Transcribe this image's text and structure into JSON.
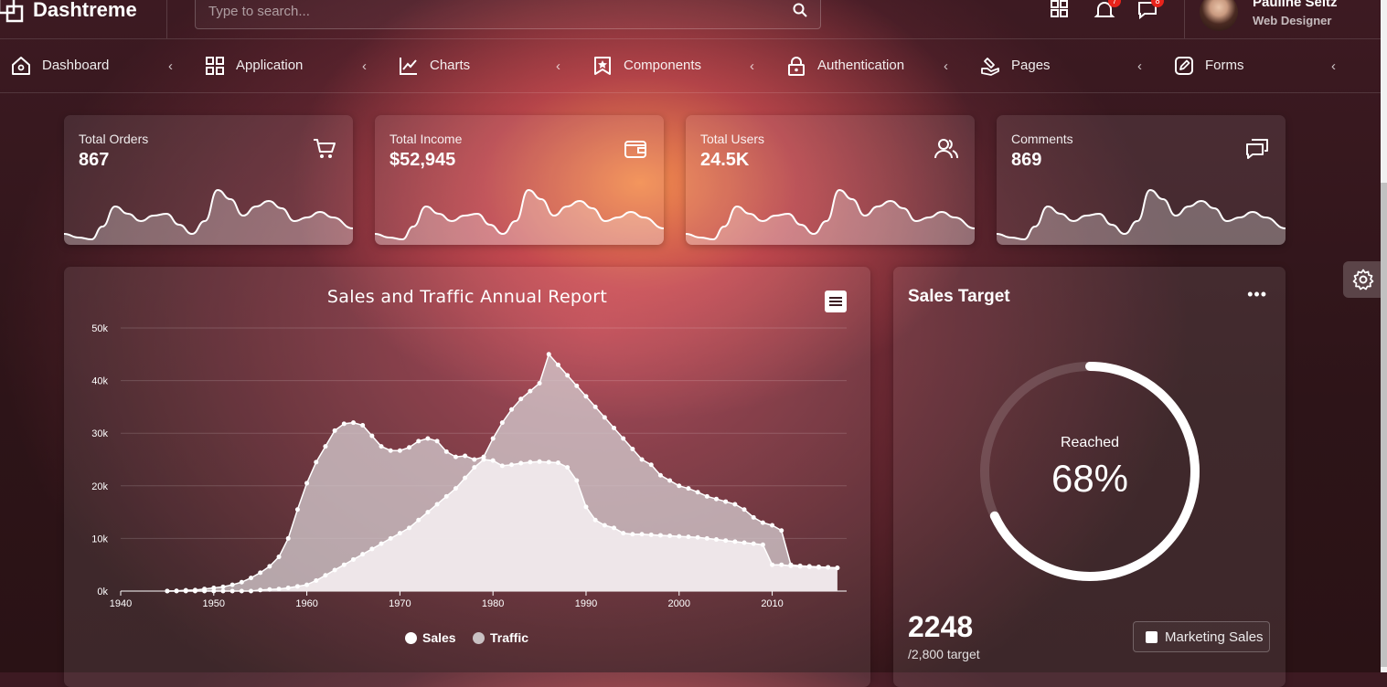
{
  "app": {
    "title": "Dashtreme"
  },
  "search": {
    "placeholder": "Type to search..."
  },
  "header": {
    "notifications_count": "7",
    "messages_count": "8"
  },
  "user": {
    "name": "Pauline Seitz",
    "role": "Web Designer"
  },
  "nav": {
    "items": [
      {
        "label": "Dashboard",
        "icon": "home-icon"
      },
      {
        "label": "Application",
        "icon": "grid-icon"
      },
      {
        "label": "Charts",
        "icon": "chart-line-icon"
      },
      {
        "label": "Components",
        "icon": "bookmark-icon"
      },
      {
        "label": "Authentication",
        "icon": "lock-icon"
      },
      {
        "label": "Pages",
        "icon": "pages-icon"
      },
      {
        "label": "Forms",
        "icon": "edit-icon"
      }
    ]
  },
  "stats": [
    {
      "label": "Total Orders",
      "value": "867",
      "icon": "cart-icon"
    },
    {
      "label": "Total Income",
      "value": "$52,945",
      "icon": "wallet-icon"
    },
    {
      "label": "Total Users",
      "value": "24.5K",
      "icon": "users-icon"
    },
    {
      "label": "Comments",
      "value": "869",
      "icon": "comments-icon"
    }
  ],
  "sales_target": {
    "title": "Sales Target",
    "gauge_label": "Reached",
    "gauge_value": "68%",
    "percent": 68,
    "number": "2248",
    "target": "/2,800 target",
    "button": "Marketing Sales"
  },
  "chart_data": {
    "type": "area",
    "title": "Sales and Traffic Annual Report",
    "xlim": [
      1940,
      2018
    ],
    "ylim": [
      0,
      50000
    ],
    "x_ticks": [
      1940,
      1950,
      1960,
      1970,
      1980,
      1990,
      2000,
      2010
    ],
    "y_ticks": [
      0,
      10000,
      20000,
      30000,
      40000,
      50000
    ],
    "y_tick_labels": [
      "0k",
      "10k",
      "20k",
      "30k",
      "40k",
      "50k"
    ],
    "grid": true,
    "legend": "bottom",
    "series": [
      {
        "name": "Sales",
        "color": "#ffffff",
        "x": [
          1945,
          1946,
          1947,
          1948,
          1949,
          1950,
          1951,
          1952,
          1953,
          1954,
          1955,
          1956,
          1957,
          1958,
          1959,
          1960,
          1961,
          1962,
          1963,
          1964,
          1965,
          1966,
          1967,
          1968,
          1969,
          1970,
          1971,
          1972,
          1973,
          1974,
          1975,
          1976,
          1977,
          1978,
          1979,
          1980,
          1981,
          1982,
          1983,
          1984,
          1985,
          1986,
          1987,
          1988,
          1989,
          1990,
          1991,
          1992,
          1993,
          1994,
          1995,
          1996,
          1997,
          1998,
          1999,
          2000,
          2001,
          2002,
          2003,
          2004,
          2005,
          2006,
          2007,
          2008,
          2009,
          2010,
          2011,
          2012,
          2013,
          2014,
          2015,
          2016,
          2017
        ],
        "y": [
          0,
          0,
          0,
          0,
          0,
          0,
          0,
          0,
          0,
          0,
          200,
          300,
          400,
          600,
          900,
          1200,
          2000,
          3000,
          4000,
          5000,
          6000,
          7000,
          8000,
          9000,
          10000,
          11000,
          12000,
          13500,
          15000,
          16500,
          18000,
          19500,
          21500,
          23500,
          25000,
          24800,
          23800,
          24000,
          24300,
          24500,
          24600,
          24500,
          24400,
          23500,
          21000,
          16000,
          13500,
          12500,
          12000,
          11000,
          10800,
          10800,
          10700,
          10600,
          10500,
          10400,
          10300,
          10200,
          10000,
          9800,
          9600,
          9400,
          9200,
          9000,
          8800,
          5000,
          5000,
          4800,
          4700,
          4600,
          4500,
          4500,
          4400
        ]
      },
      {
        "name": "Traffic",
        "color": "#c9c1c3",
        "x": [
          1945,
          1946,
          1947,
          1948,
          1949,
          1950,
          1951,
          1952,
          1953,
          1954,
          1955,
          1956,
          1957,
          1958,
          1959,
          1960,
          1961,
          1962,
          1963,
          1964,
          1965,
          1966,
          1967,
          1968,
          1969,
          1970,
          1971,
          1972,
          1973,
          1974,
          1975,
          1976,
          1977,
          1978,
          1979,
          1980,
          1981,
          1982,
          1983,
          1984,
          1985,
          1986,
          1987,
          1988,
          1989,
          1990,
          1991,
          1992,
          1993,
          1994,
          1995,
          1996,
          1997,
          1998,
          1999,
          2000,
          2001,
          2002,
          2003,
          2004,
          2005,
          2006,
          2007,
          2008,
          2009,
          2010,
          2011,
          2012,
          2013,
          2014,
          2015,
          2016,
          2017
        ],
        "y": [
          0,
          50,
          150,
          200,
          400,
          600,
          800,
          1200,
          1700,
          2500,
          3500,
          4700,
          6500,
          10000,
          15500,
          20500,
          24500,
          27500,
          30500,
          31800,
          32000,
          31500,
          29500,
          27500,
          26700,
          26700,
          27300,
          28500,
          29000,
          28500,
          26500,
          25500,
          25700,
          25000,
          25500,
          29000,
          32000,
          34500,
          36500,
          38000,
          39500,
          45000,
          43000,
          41000,
          39000,
          37000,
          35000,
          33000,
          31000,
          29000,
          27000,
          25000,
          24000,
          22000,
          21000,
          20000,
          19500,
          18800,
          18000,
          17500,
          17000,
          16500,
          15500,
          14000,
          13000,
          12500,
          11500,
          5000,
          4800,
          4700,
          4600,
          4500,
          4400
        ]
      }
    ]
  }
}
